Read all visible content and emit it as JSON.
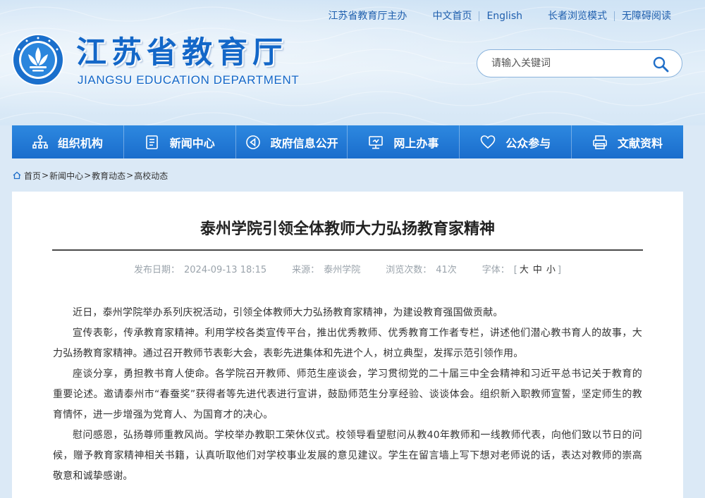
{
  "colors": {
    "brand": "#1367c8",
    "nav": "#1f74d4",
    "page_bg": "#dbe9f6"
  },
  "toplinks": {
    "host": "江苏省教育厅主办",
    "chinese": "中文首页",
    "english": "English",
    "elder": "长者浏览模式",
    "accessible": "无障碍阅读"
  },
  "logo": {
    "name_cn": "江苏省教育厅",
    "name_en": "JIANGSU EDUCATION DEPARTMENT",
    "emblem_icon": "education-emblem-icon"
  },
  "search": {
    "placeholder": "请输入关键词",
    "icon": "search-icon"
  },
  "nav": [
    {
      "label": "组织机构",
      "icon": "org-tree-icon"
    },
    {
      "label": "新闻中心",
      "icon": "news-document-icon"
    },
    {
      "label": "政府信息公开",
      "icon": "info-disclosure-icon"
    },
    {
      "label": "网上办事",
      "icon": "monitor-icon"
    },
    {
      "label": "公众参与",
      "icon": "heart-icon"
    },
    {
      "label": "文献资料",
      "icon": "printer-icon"
    }
  ],
  "breadcrumb": {
    "icon": "home-icon",
    "items": [
      "首页",
      "新闻中心",
      "教育动态",
      "高校动态"
    ],
    "separator": ">"
  },
  "article": {
    "title": "泰州学院引领全体教师大力弘扬教育家精神",
    "meta": {
      "date_label": "发布日期：",
      "date": "2024-09-13 18:15",
      "source_label": "来源：",
      "source": "泰州学院",
      "views_label": "浏览次数：",
      "views": "41次",
      "font_label": "字体：",
      "font_large": "大",
      "font_medium": "中",
      "font_small": "小"
    },
    "paragraphs": [
      "近日，泰州学院举办系列庆祝活动，引领全体教师大力弘扬教育家精神，为建设教育强国做贡献。",
      "宣传表彰，传承教育家精神。利用学校各类宣传平台，推出优秀教师、优秀教育工作者专栏，讲述他们潜心教书育人的故事，大力弘扬教育家精神。通过召开教师节表彰大会，表彰先进集体和先进个人，树立典型，发挥示范引领作用。",
      "座谈分享，勇担教书育人使命。各学院召开教师、师范生座谈会，学习贯彻党的二十届三中全会精神和习近平总书记关于教育的重要论述。邀请泰州市“春蚕奖”获得者等先进代表进行宣讲，鼓励师范生分享经验、谈谈体会。组织新入职教师宣誓，坚定师生的教育情怀，进一步增强为党育人、为国育才的决心。",
      "慰问感恩，弘扬尊师重教风尚。学校举办教职工荣休仪式。校领导看望慰问从教40年教师和一线教师代表，向他们致以节日的问候，赠予教育家精神相关书籍，认真听取他们对学校事业发展的意见建议。学生在留言墙上写下想对老师说的话，表达对教师的崇高敬意和诚挚感谢。"
    ]
  }
}
